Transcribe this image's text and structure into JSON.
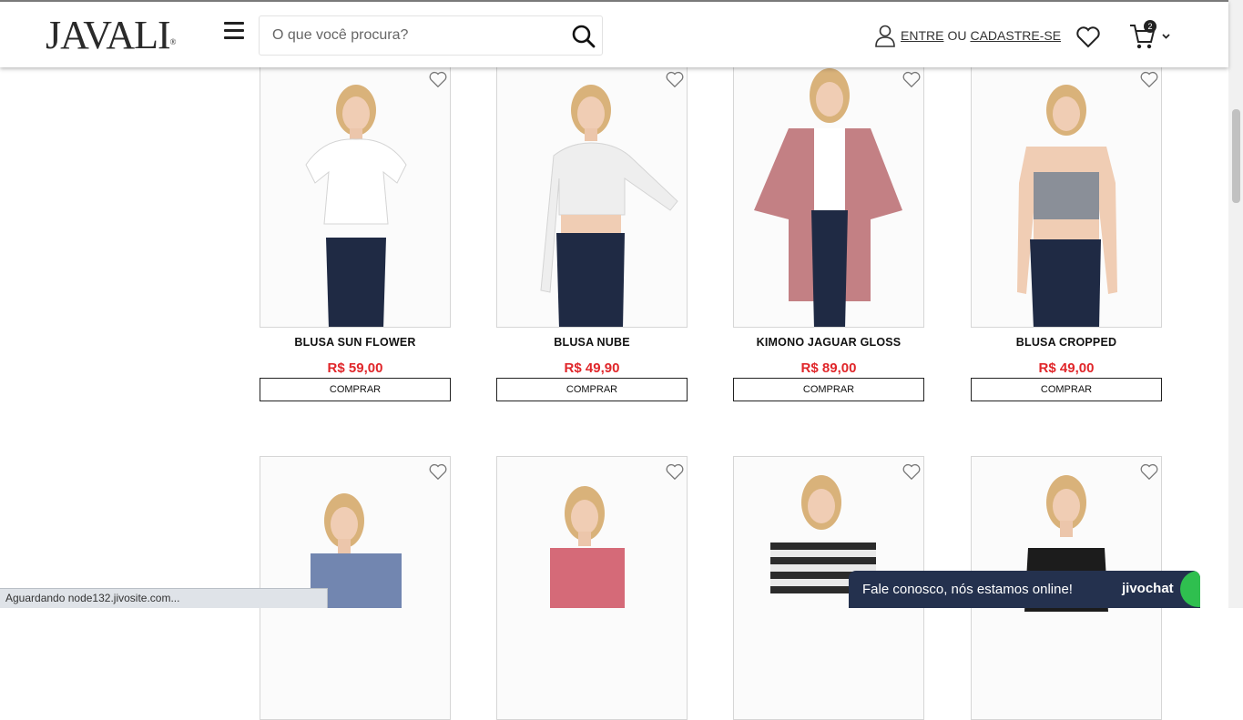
{
  "header": {
    "logo": "JAVALI",
    "logo_mark": "®",
    "search_placeholder": "O que você procura?",
    "login_label": "ENTRE",
    "or_label": "OU",
    "register_label": "CADASTRE-SE",
    "cart_count": "2"
  },
  "products": [
    {
      "name": "BLUSA SUN FLOWER",
      "price": "R$ 59,00",
      "button": "COMPRAR"
    },
    {
      "name": "BLUSA NUBE",
      "price": "R$ 49,90",
      "button": "COMPRAR"
    },
    {
      "name": "KIMONO JAGUAR GLOSS",
      "price": "R$ 89,00",
      "button": "COMPRAR"
    },
    {
      "name": "BLUSA CROPPED",
      "price": "R$ 49,00",
      "button": "COMPRAR"
    }
  ],
  "status_bar": "Aguardando node132.jivosite.com...",
  "chat": {
    "message": "Fale conosco, nós estamos online!",
    "brand": "jivochat"
  },
  "colors": {
    "price": "#e0262a",
    "chat_bg": "#24314e",
    "chat_accent": "#2fbf4f"
  }
}
